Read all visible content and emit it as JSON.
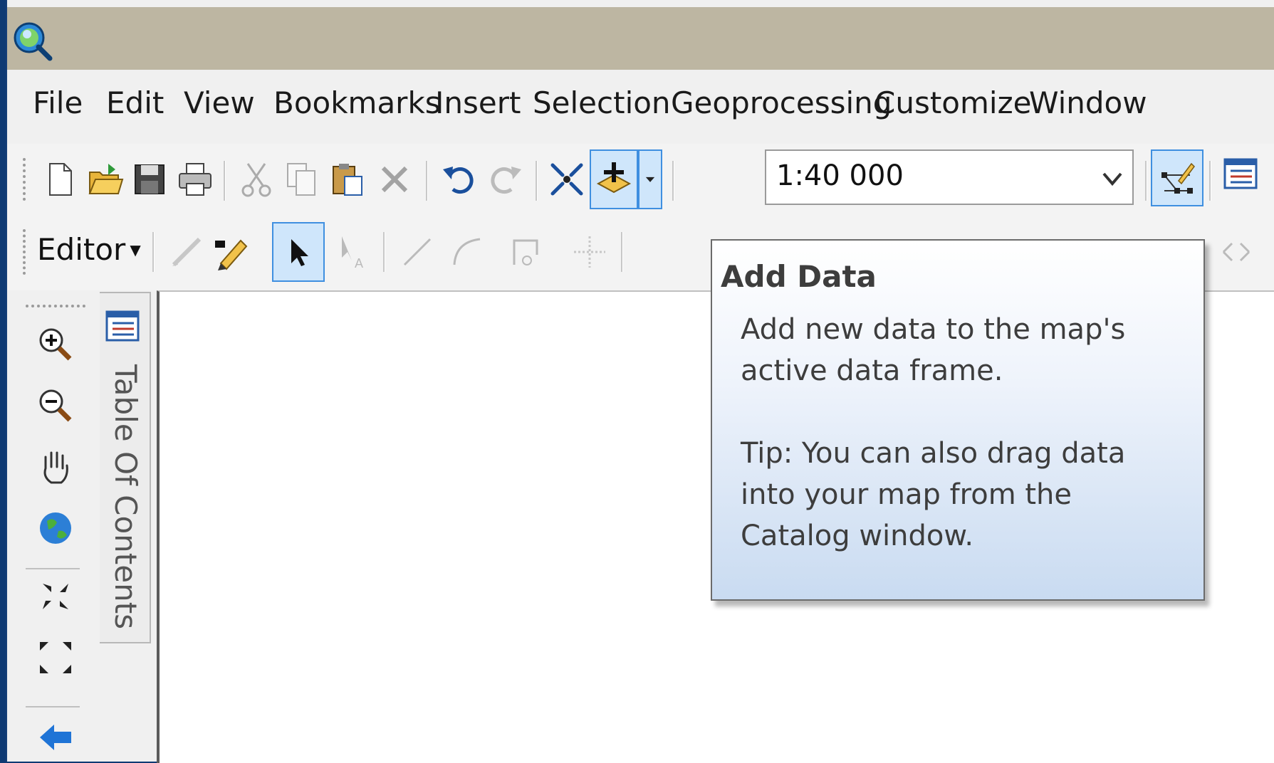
{
  "menu": {
    "items": [
      "File",
      "Edit",
      "View",
      "Bookmarks",
      "Insert",
      "Selection",
      "Geoprocessing",
      "Customize",
      "Window"
    ]
  },
  "toolbar": {
    "scale_value": "1:40 000"
  },
  "editor_toolbar": {
    "editor_label": "Editor"
  },
  "toc": {
    "label": "Table Of Contents"
  },
  "tooltip": {
    "title": "Add Data",
    "description": "Add new data to the map's active data frame.",
    "tip": "Tip: You can also drag data into your map from the Catalog window."
  },
  "colors": {
    "titlebar": "#bdb6a2",
    "active_button_fill": "#cfe6fb",
    "active_button_border": "#3f8fe0",
    "desktop": "#0f3a73"
  },
  "icons": [
    "new-document-icon",
    "open-folder-icon",
    "save-icon",
    "print-icon",
    "cut-icon",
    "copy-icon",
    "paste-icon",
    "delete-icon",
    "undo-icon",
    "redo-icon",
    "full-extent-icon",
    "add-data-icon",
    "dropdown-arrow-icon",
    "editor-toolbar-icon",
    "table-of-contents-icon",
    "sketch-icon",
    "pencil-icon",
    "select-arrow-icon",
    "edit-annotation-icon",
    "straight-segment-icon",
    "arc-segment-icon",
    "trace-icon",
    "midpoint-icon",
    "zoom-in-icon",
    "zoom-out-icon",
    "pan-hand-icon",
    "globe-icon",
    "fixed-zoom-in-icon",
    "fixed-zoom-out-icon",
    "back-arrow-icon"
  ]
}
